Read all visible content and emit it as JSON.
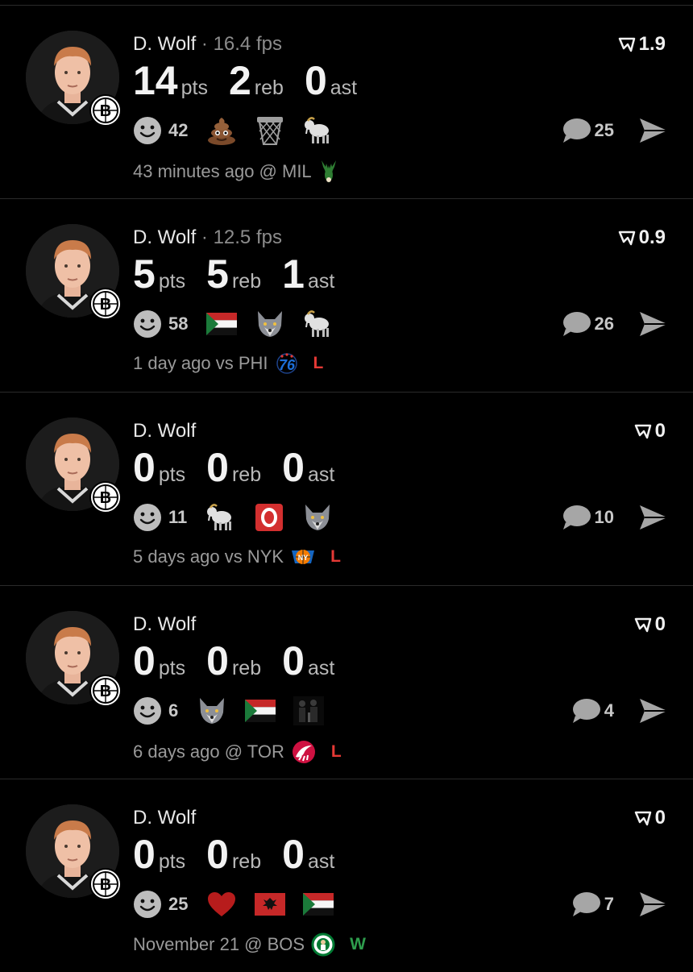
{
  "colors": {
    "background": "#000000",
    "loss": "#e53935",
    "win": "#2e9d4d",
    "muted": "#9a9a9a"
  },
  "cards": [
    {
      "player": "D. Wolf",
      "fps": "· 16.4 fps",
      "score": "1.9",
      "stats": {
        "pts": "14",
        "pts_label": "pts",
        "reb": "2",
        "reb_label": "reb",
        "ast": "0",
        "ast_label": "ast"
      },
      "reactions_count": "42",
      "reaction_icons": [
        "poop-emoji",
        "basketball-hoop-emoji",
        "goat-emoji"
      ],
      "comments": "25",
      "meta": "43 minutes ago @ MIL",
      "opponent_logo": "bucks-logo",
      "result": ""
    },
    {
      "player": "D. Wolf",
      "fps": "· 12.5 fps",
      "score": "0.9",
      "stats": {
        "pts": "5",
        "pts_label": "pts",
        "reb": "5",
        "reb_label": "reb",
        "ast": "1",
        "ast_label": "ast"
      },
      "reactions_count": "58",
      "reaction_icons": [
        "sudan-flag-emoji",
        "wolf-emoji",
        "goat-emoji"
      ],
      "comments": "26",
      "meta": "1 day ago vs PHI",
      "opponent_logo": "76ers-logo",
      "result": "L"
    },
    {
      "player": "D. Wolf",
      "fps": "",
      "score": "0",
      "stats": {
        "pts": "0",
        "pts_label": "pts",
        "reb": "0",
        "reb_label": "reb",
        "ast": "0",
        "ast_label": "ast"
      },
      "reactions_count": "11",
      "reaction_icons": [
        "goat-emoji",
        "o-button-emoji",
        "wolf-emoji"
      ],
      "comments": "10",
      "meta": "5 days ago vs NYK",
      "opponent_logo": "knicks-logo",
      "result": "L"
    },
    {
      "player": "D. Wolf",
      "fps": "",
      "score": "0",
      "stats": {
        "pts": "0",
        "pts_label": "pts",
        "reb": "0",
        "reb_label": "reb",
        "ast": "0",
        "ast_label": "ast"
      },
      "reactions_count": "6",
      "reaction_icons": [
        "wolf-emoji",
        "sudan-flag-emoji",
        "dark-figures-emoji"
      ],
      "comments": "4",
      "meta": "6 days ago @ TOR",
      "opponent_logo": "raptors-logo",
      "result": "L"
    },
    {
      "player": "D. Wolf",
      "fps": "",
      "score": "0",
      "stats": {
        "pts": "0",
        "pts_label": "pts",
        "reb": "0",
        "reb_label": "reb",
        "ast": "0",
        "ast_label": "ast"
      },
      "reactions_count": "25",
      "reaction_icons": [
        "red-heart-emoji",
        "albania-flag-emoji",
        "sudan-flag-emoji"
      ],
      "comments": "7",
      "meta": "November 21 @ BOS",
      "opponent_logo": "celtics-logo",
      "result": "W"
    }
  ]
}
